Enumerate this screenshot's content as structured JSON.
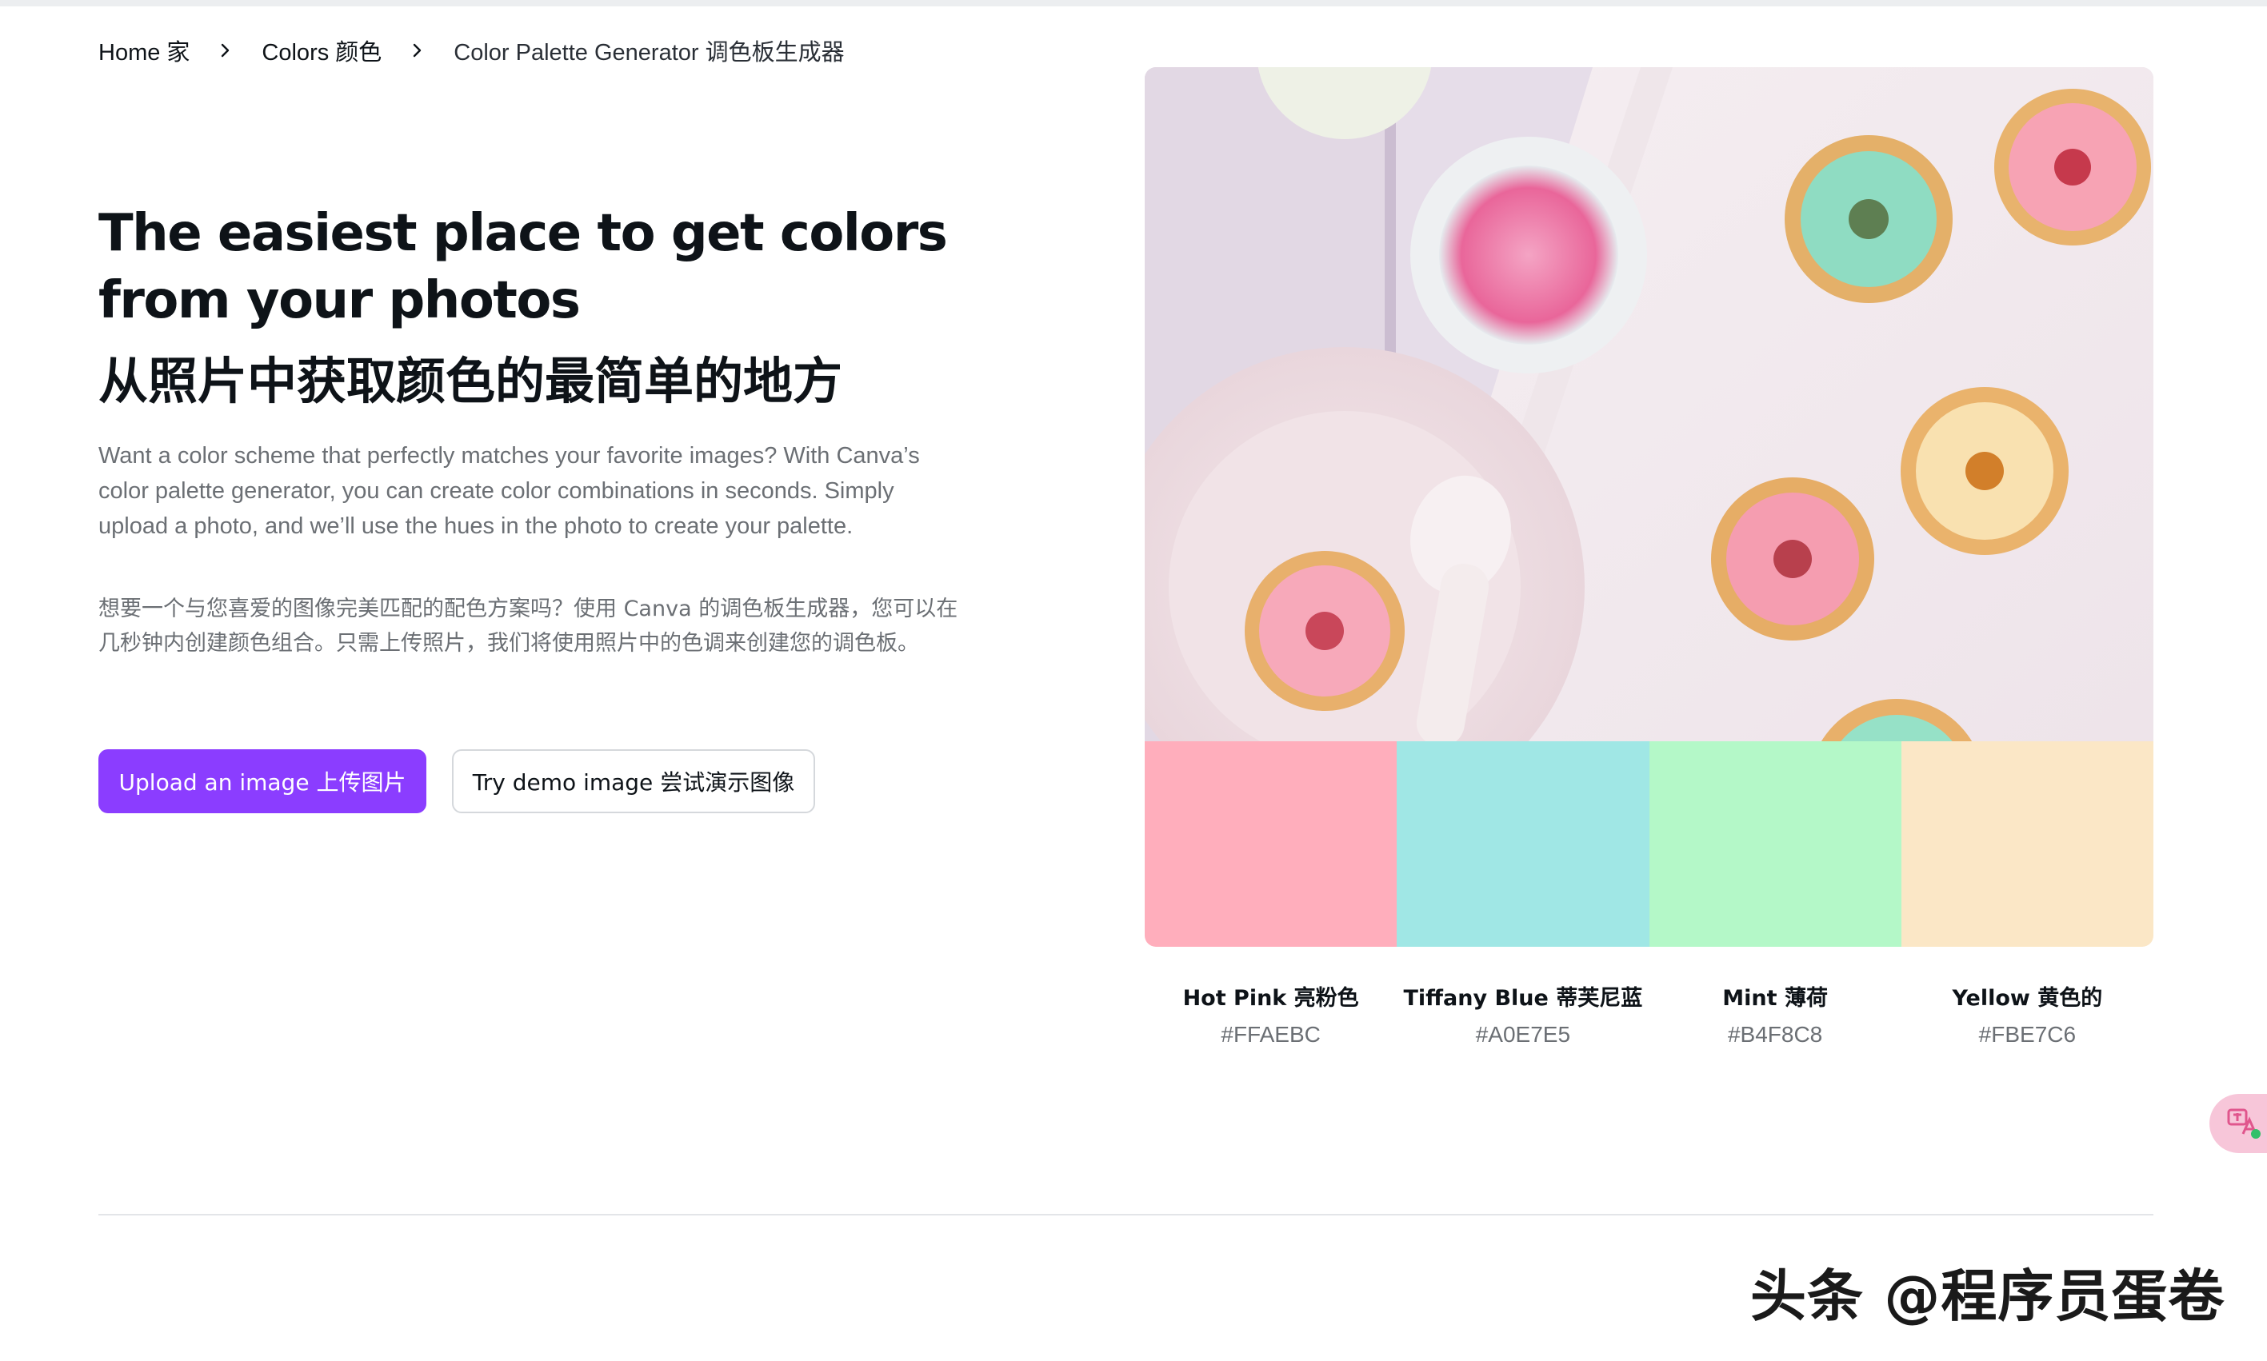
{
  "breadcrumb": {
    "home": "Home 家",
    "colors": "Colors 颜色",
    "current": "Color Palette Generator 调色板生成器"
  },
  "hero": {
    "title": "The easiest place to get colors from your photos",
    "title_cn": "从照片中获取颜色的最简单的地方",
    "description": "Want a color scheme that perfectly matches your favorite images? With Canva’s color palette generator, you can create color combinations in seconds. Simply upload a photo, and we’ll use the hues in the photo to create your palette.",
    "description_cn": "想要一个与您喜爱的图像完美匹配的配色方案吗？使用 Canva 的调色板生成器，您可以在几秒钟内创建颜色组合。只需上传照片，我们将使用照片中的色调来创建您的调色板。",
    "upload_label": "Upload an image 上传图片",
    "demo_label": "Try demo image 尝试演示图像"
  },
  "palette": [
    {
      "name": "Hot Pink 亮粉色",
      "hex": "#FFAEBC"
    },
    {
      "name": "Tiffany Blue 蒂芙尼蓝",
      "hex": "#A0E7E5"
    },
    {
      "name": "Mint 薄荷",
      "hex": "#B4F8C8"
    },
    {
      "name": "Yellow 黄色的",
      "hex": "#FBE7C6"
    }
  ],
  "colors": {
    "accent": "#8B3DFF",
    "text": "#0E1318",
    "muted": "#6B6F74"
  },
  "icons": {
    "breadcrumb_separator": "chevron-right-icon",
    "floating": "translate-icon"
  },
  "watermark": "头条 @程序员蛋卷"
}
